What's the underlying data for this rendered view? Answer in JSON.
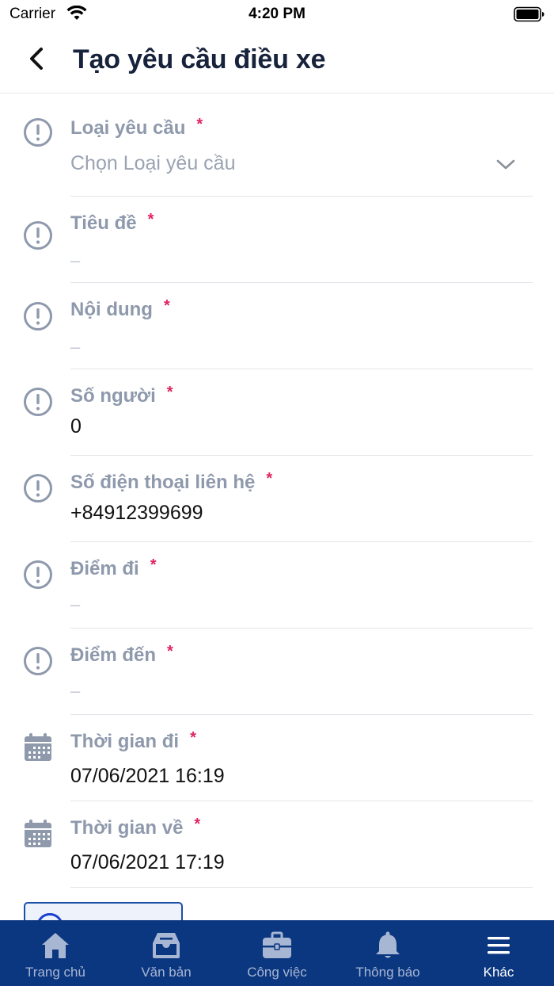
{
  "status_bar": {
    "carrier": "Carrier",
    "time": "4:20 PM"
  },
  "header": {
    "title": "Tạo yêu cầu điều xe",
    "back_icon": "chevron-left-icon"
  },
  "required_marker": "*",
  "form": {
    "fields": [
      {
        "label": "Loại yêu cầu",
        "value": "Chọn Loại yêu cầu",
        "icon": "info-icon",
        "kind": "select"
      },
      {
        "label": "Tiêu đề",
        "value": "–",
        "icon": "info-icon",
        "kind": "text"
      },
      {
        "label": "Nội dung",
        "value": "–",
        "icon": "info-icon",
        "kind": "text"
      },
      {
        "label": "Số người",
        "value": "0",
        "icon": "info-icon",
        "kind": "text"
      },
      {
        "label": "Số điện thoại liên hệ",
        "value": "+84912399699",
        "icon": "info-icon",
        "kind": "text"
      },
      {
        "label": "Điểm đi",
        "value": "–",
        "icon": "info-icon",
        "kind": "text"
      },
      {
        "label": "Điểm đến",
        "value": "–",
        "icon": "info-icon",
        "kind": "text"
      },
      {
        "label": "Thời gian đi",
        "value": "07/06/2021 16:19",
        "icon": "calendar-icon",
        "kind": "datetime"
      },
      {
        "label": "Thời gian về",
        "value": "07/06/2021 17:19",
        "icon": "calendar-icon",
        "kind": "datetime"
      }
    ]
  },
  "tab_bar": {
    "items": [
      {
        "label": "Trang chủ",
        "icon": "home-icon"
      },
      {
        "label": "Văn bản",
        "icon": "inbox-icon"
      },
      {
        "label": "Công việc",
        "icon": "briefcase-icon"
      },
      {
        "label": "Thông báo",
        "icon": "bell-icon"
      },
      {
        "label": "Khác",
        "icon": "menu-icon",
        "active": true
      }
    ]
  },
  "colors": {
    "title": "#17223b",
    "label": "#8e99ac",
    "required": "#e0245e",
    "tab_bar_bg": "#0b3680",
    "tab_inactive": "#a7b6d3",
    "tab_active": "#ffffff"
  }
}
